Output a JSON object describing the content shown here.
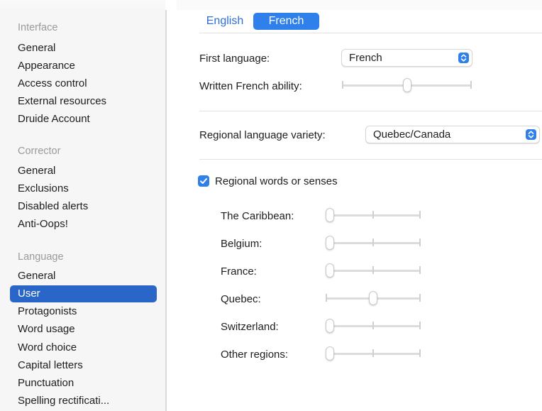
{
  "sidebar": {
    "sections": [
      {
        "heading": "Interface",
        "items": [
          "General",
          "Appearance",
          "Access control",
          "External resources",
          "Druide Account"
        ]
      },
      {
        "heading": "Corrector",
        "items": [
          "General",
          "Exclusions",
          "Disabled alerts",
          "Anti-Oops!"
        ]
      },
      {
        "heading": "Language",
        "items": [
          "General",
          "User",
          "Protagonists",
          "Word usage",
          "Word choice",
          "Capital letters",
          "Punctuation",
          "Spelling rectificati..."
        ]
      }
    ],
    "selected_item": "User"
  },
  "tabs": [
    {
      "label": "English",
      "selected": false
    },
    {
      "label": "French",
      "selected": true
    }
  ],
  "settings": {
    "first_language": {
      "label": "First language:",
      "value": "French"
    },
    "written_french": {
      "label": "Written French ability:",
      "level": 0.5
    },
    "regional_variety": {
      "label": "Regional language variety:",
      "value": "Quebec/Canada"
    },
    "regional_words": {
      "label": "Regional words or senses",
      "checked": true
    },
    "regions": [
      {
        "label": "The Caribbean:",
        "level": 0.0
      },
      {
        "label": "Belgium:",
        "level": 0.0
      },
      {
        "label": "France:",
        "level": 0.0
      },
      {
        "label": "Quebec:",
        "level": 0.5
      },
      {
        "label": "Switzerland:",
        "level": 0.0
      },
      {
        "label": "Other regions:",
        "level": 0.0
      }
    ]
  },
  "colors": {
    "accent": "#2f80ea",
    "selection": "#2a66c8",
    "tab_link": "#2e6fd6",
    "section_heading": "#9a9a9a"
  },
  "icons": [
    "chevron-updown-icon",
    "checkmark-icon"
  ]
}
